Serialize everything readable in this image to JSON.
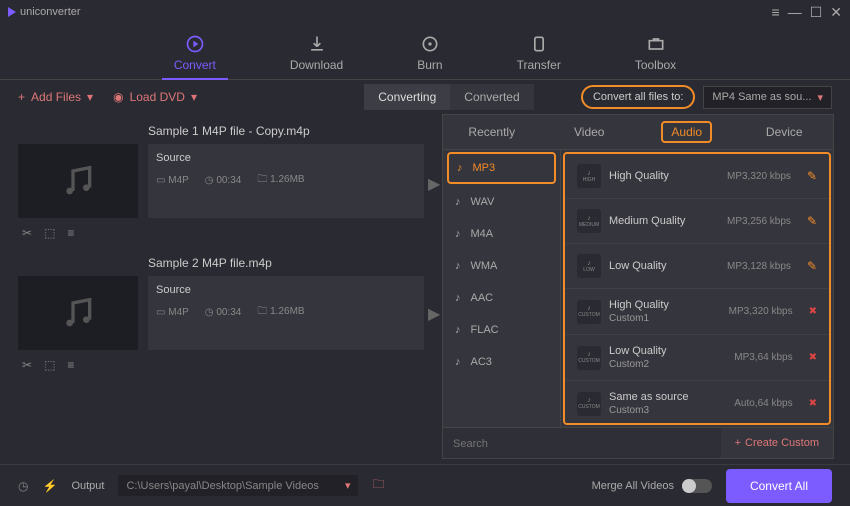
{
  "app": {
    "title": "uniconverter"
  },
  "nav": {
    "convert": "Convert",
    "download": "Download",
    "burn": "Burn",
    "transfer": "Transfer",
    "toolbox": "Toolbox"
  },
  "toolbar": {
    "add_files": "Add Files",
    "load_dvd": "Load DVD",
    "converting": "Converting",
    "converted": "Converted",
    "convert_all": "Convert all files to:",
    "target": "MP4 Same as sou..."
  },
  "files": [
    {
      "name": "Sample 1 M4P file - Copy.m4p",
      "source": "Source",
      "fmt": "M4P",
      "dur": "00:34",
      "size": "1.26MB"
    },
    {
      "name": "Sample 2 M4P file.m4p",
      "source": "Source",
      "fmt": "M4P",
      "dur": "00:34",
      "size": "1.26MB"
    }
  ],
  "panel": {
    "tabs": {
      "recently": "Recently",
      "video": "Video",
      "audio": "Audio",
      "device": "Device"
    },
    "formats": [
      "MP3",
      "WAV",
      "M4A",
      "WMA",
      "AAC",
      "FLAC",
      "AC3"
    ],
    "qualities": [
      {
        "name": "High Quality",
        "spec": "MP3,320 kbps",
        "icon": "HIGH",
        "act": "edit"
      },
      {
        "name": "Medium Quality",
        "spec": "MP3,256 kbps",
        "icon": "MEDIUM",
        "act": "edit"
      },
      {
        "name": "Low Quality",
        "spec": "MP3,128 kbps",
        "icon": "LOW",
        "act": "edit"
      },
      {
        "name": "High Quality",
        "name2": "Custom1",
        "spec": "MP3,320 kbps",
        "icon": "CUSTOM",
        "act": "del"
      },
      {
        "name": "Low Quality",
        "name2": "Custom2",
        "spec": "MP3,64 kbps",
        "icon": "CUSTOM",
        "act": "del"
      },
      {
        "name": "Same as source",
        "name2": "Custom3",
        "spec": "Auto,64 kbps",
        "icon": "CUSTOM",
        "act": "del"
      }
    ],
    "search_ph": "Search",
    "create": "Create Custom"
  },
  "bottom": {
    "output": "Output",
    "path": "C:\\Users\\payal\\Desktop\\Sample Videos",
    "merge": "Merge All Videos",
    "convert": "Convert All"
  }
}
